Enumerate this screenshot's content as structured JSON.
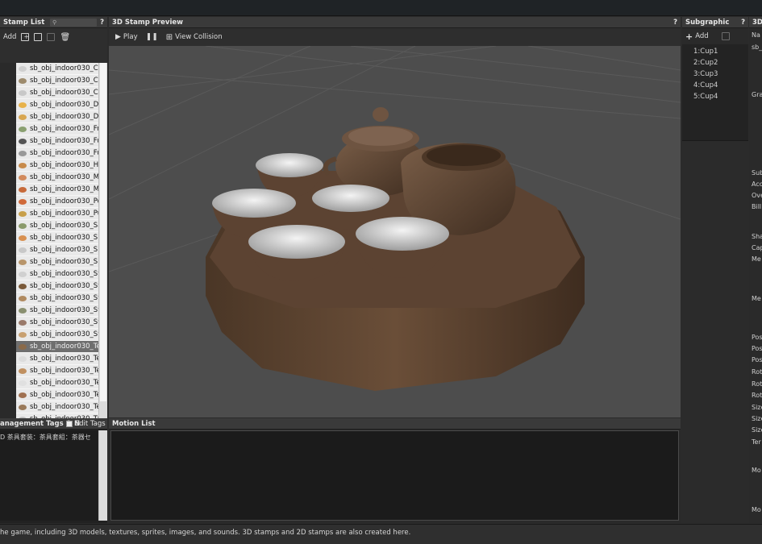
{
  "stamp_list": {
    "title": "Stamp List",
    "help": "?",
    "add_label": "Add",
    "items": [
      "sb_obj_indoor030_Ch",
      "sb_obj_indoor030_Ch",
      "sb_obj_indoor030_Ch",
      "sb_obj_indoor030_Da",
      "sb_obj_indoor030_De",
      "sb_obj_indoor030_Fr",
      "sb_obj_indoor030_Fu",
      "sb_obj_indoor030_Fu",
      "sb_obj_indoor030_He",
      "sb_obj_indoor030_Mi",
      "sb_obj_indoor030_Mi",
      "sb_obj_indoor030_Po",
      "sb_obj_indoor030_Pu",
      "sb_obj_indoor030_Sa",
      "sb_obj_indoor030_Sh",
      "sb_obj_indoor030_Sh",
      "sb_obj_indoor030_Sp",
      "sb_obj_indoor030_St",
      "sb_obj_indoor030_St",
      "sb_obj_indoor030_St",
      "sb_obj_indoor030_St",
      "sb_obj_indoor030_Sw",
      "sb_obj_indoor030_Sw",
      "sb_obj_indoor030_Te",
      "sb_obj_indoor030_Te",
      "sb_obj_indoor030_Te",
      "sb_obj_indoor030_Te",
      "sb_obj_indoor030_Te",
      "sb_obj_indoor030_Te",
      "sb_obj_indoor030_Tv"
    ],
    "selected_index": 23
  },
  "preview": {
    "title": "3D Stamp Preview",
    "help": "?",
    "play_label": "Play",
    "view_collision_label": "View Collision"
  },
  "subgraphic": {
    "title": "Subgraphic",
    "help": "?",
    "add_label": "Add",
    "items": [
      "1:Cup1",
      "2:Cup2",
      "3:Cup3",
      "4:Cup4",
      "5:Cup4"
    ]
  },
  "right_panel": {
    "title": "3D",
    "labels": [
      "Na",
      "sb_",
      "Gra",
      "Sub",
      "Acc",
      "Ove",
      "Bill",
      "Sha",
      "Cap",
      "Me",
      "Me",
      "Pos",
      "Pos",
      "Pos",
      "Rot",
      "Rot",
      "Rot",
      "Size",
      "Size",
      "Size",
      "Ter",
      "Mo",
      "Mo"
    ]
  },
  "tags": {
    "title": "anagement Tags & N",
    "edit_label": "Edit Tags",
    "content": "D 茶具套装：茶具套組：茶器セ"
  },
  "motion": {
    "title": "Motion List"
  },
  "statusbar": {
    "text": "he game, including 3D models, textures, sprites, images, and sounds. 3D stamps and 2D stamps are also created here."
  }
}
